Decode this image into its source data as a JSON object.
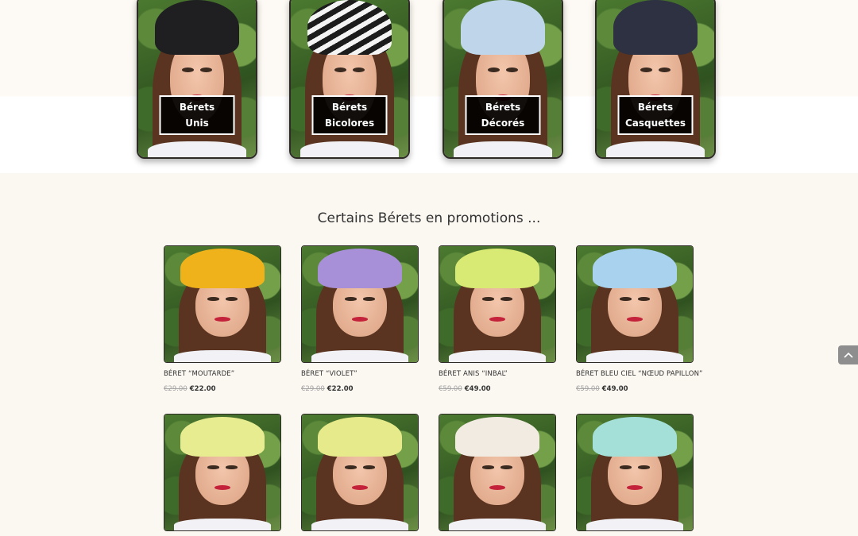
{
  "categories": [
    {
      "line1": "Bérets",
      "line2": "Unis",
      "hat_color": "#1f1f22"
    },
    {
      "line1": "Bérets",
      "line2": "Bicolores",
      "hat_color": "#1c1c1c"
    },
    {
      "line1": "Bérets",
      "line2": "Décorés",
      "hat_color": "#bfd6ea"
    },
    {
      "line1": "Bérets",
      "line2": "Casquettes",
      "hat_color": "#2d3142"
    }
  ],
  "promo": {
    "title": "Certains Bérets en promotions ...",
    "products": [
      {
        "name": "BÉRET “MOUTARDE”",
        "old_price": "€29.00",
        "new_price": "€22.00",
        "hat_color": "#f0b21a"
      },
      {
        "name": "BÉRET “VIOLET”",
        "old_price": "€29.00",
        "new_price": "€22.00",
        "hat_color": "#a890d8"
      },
      {
        "name": "BÉRET ANIS “INBAL”",
        "old_price": "€59.00",
        "new_price": "€49.00",
        "hat_color": "#d9ea74"
      },
      {
        "name": "BÉRET BLEU CIEL “NŒUD PAPILLON”",
        "old_price": "€59.00",
        "new_price": "€49.00",
        "hat_color": "#a9d2ee"
      },
      {
        "name": "",
        "old_price": "",
        "new_price": "",
        "hat_color": "#e8ec90"
      },
      {
        "name": "",
        "old_price": "",
        "new_price": "",
        "hat_color": "#e6ea8a"
      },
      {
        "name": "",
        "old_price": "",
        "new_price": "",
        "hat_color": "#f1ebe2"
      },
      {
        "name": "",
        "old_price": "",
        "new_price": "",
        "hat_color": "#a4e0d8"
      }
    ]
  },
  "icons": {
    "scroll_top": "chevron-up-icon"
  }
}
